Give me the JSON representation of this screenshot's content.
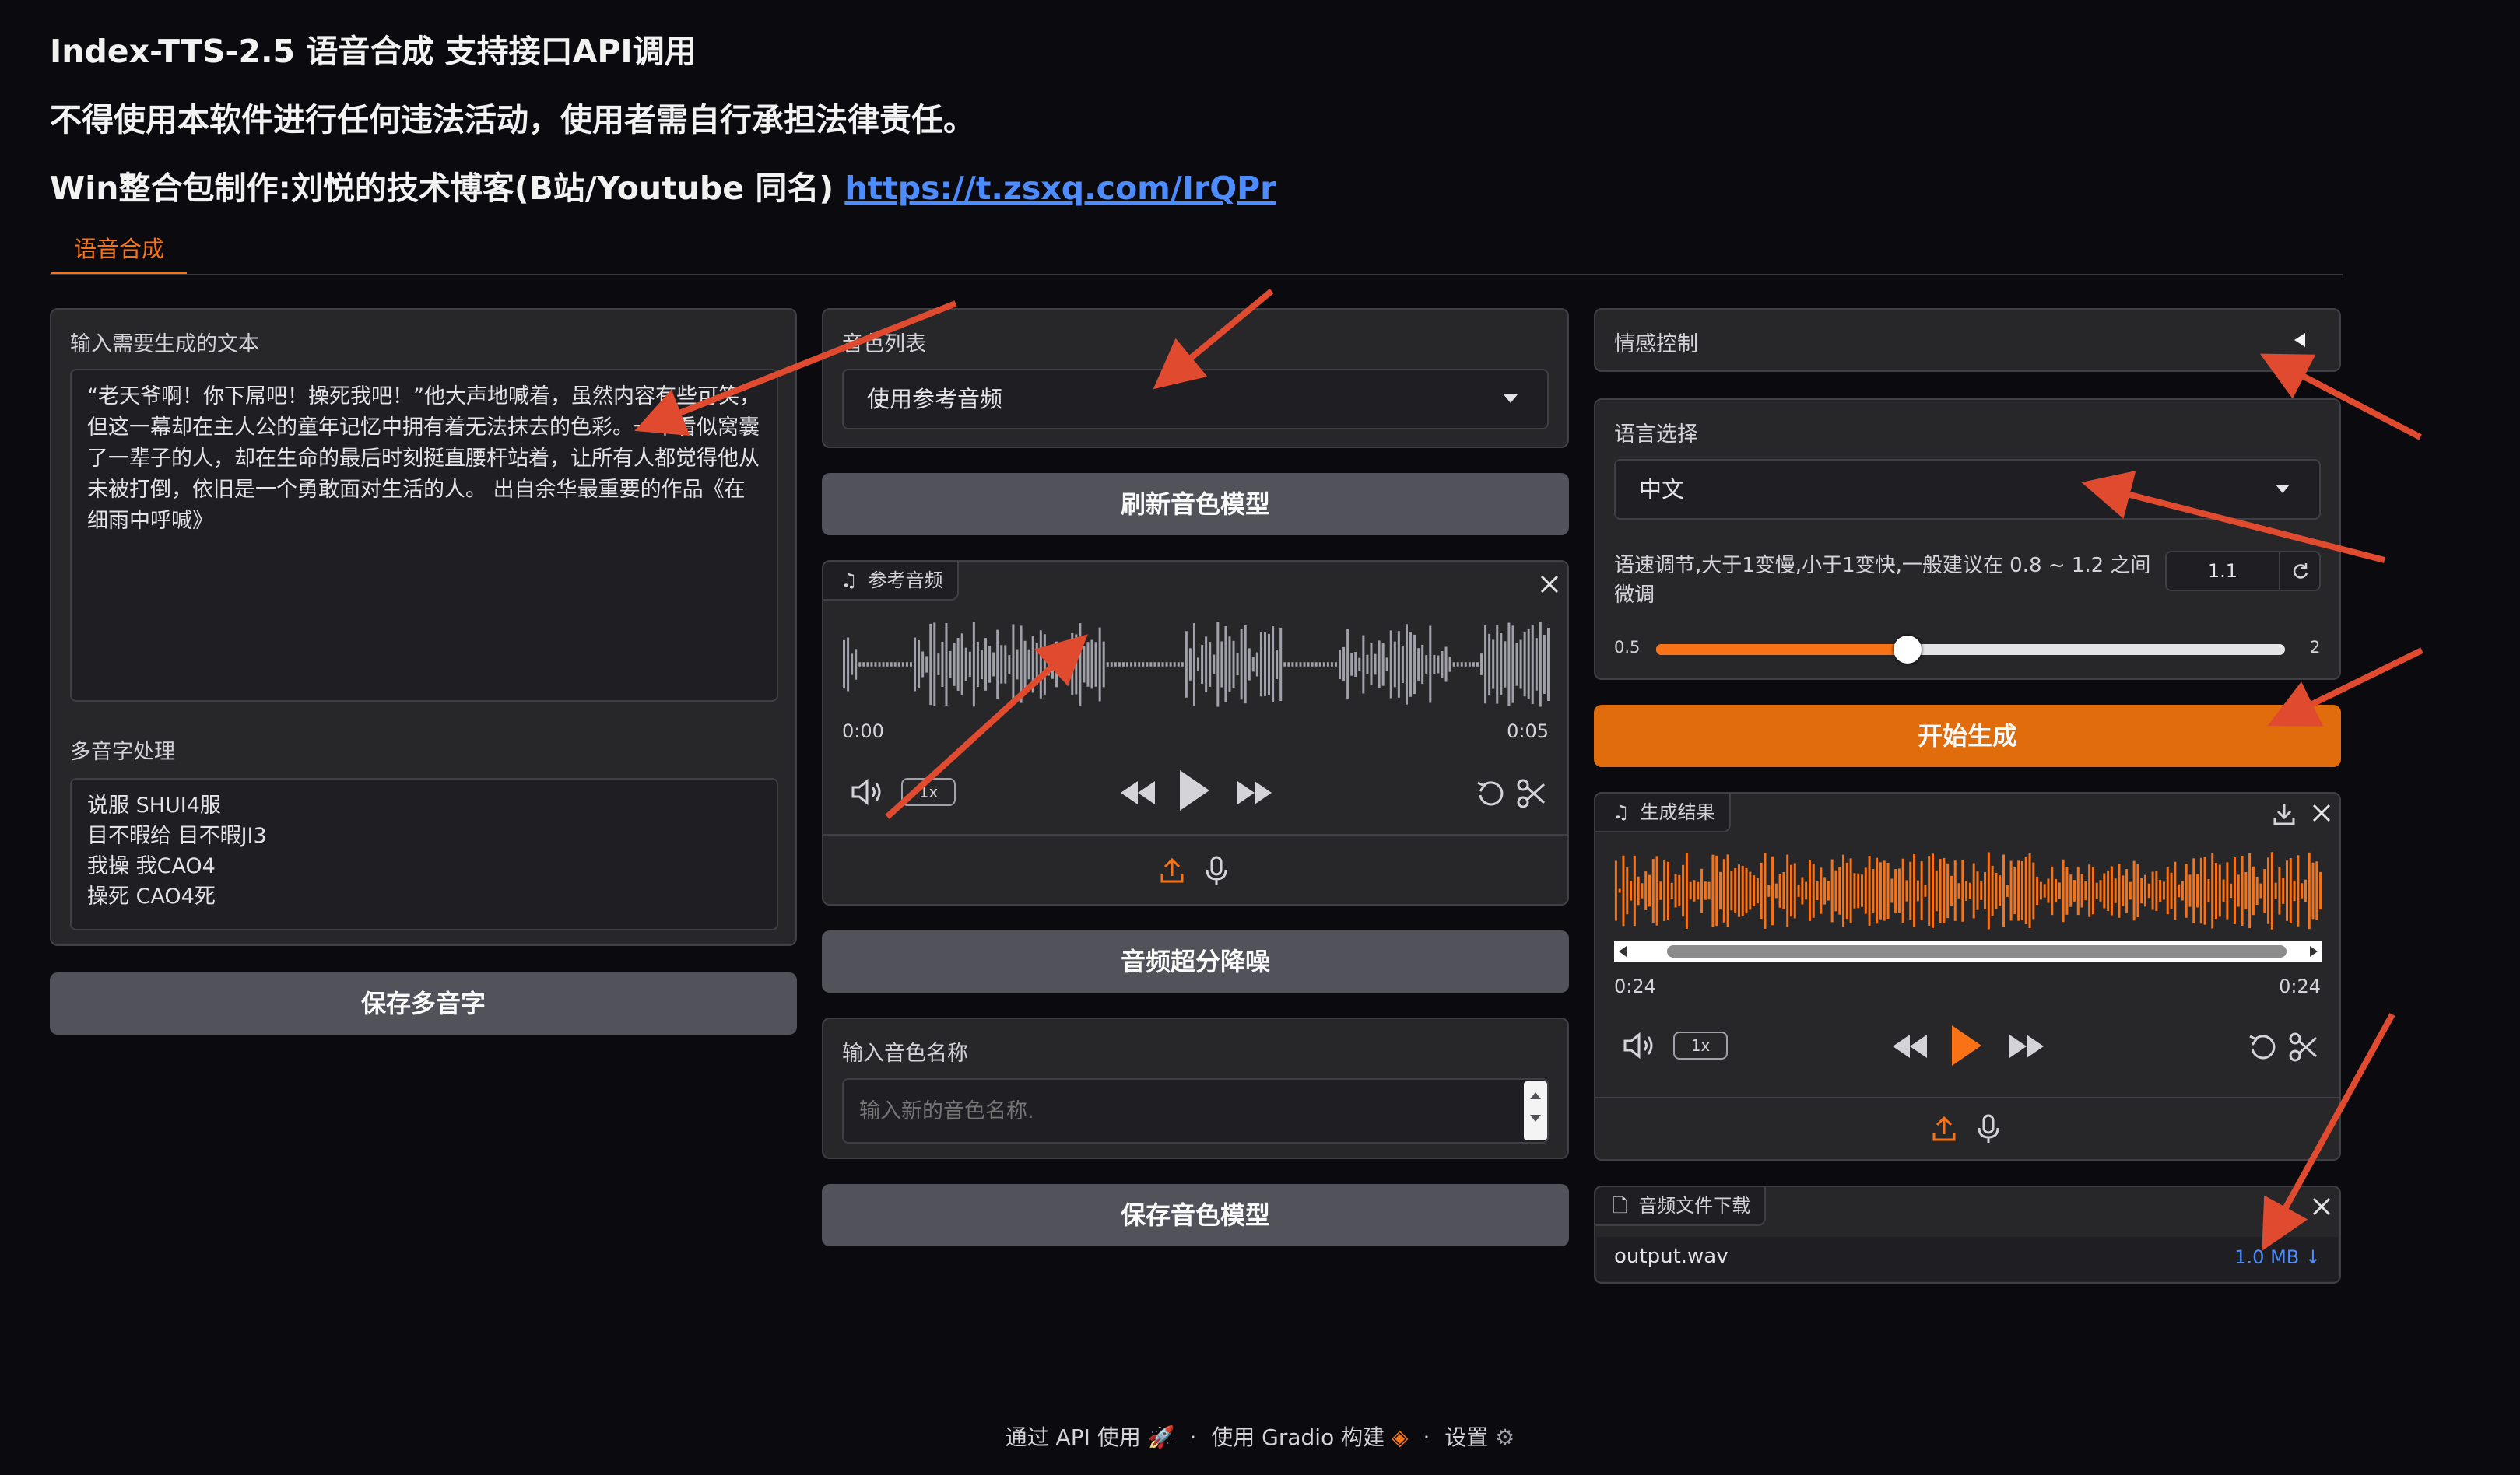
{
  "header": {
    "title": "Index-TTS-2.5 语音合成 支持接口API调用",
    "warning": "不得使用本软件进行任何违法活动，使用者需自行承担法律责任。",
    "credit_text": "Win整合包制作:刘悦的技术博客(B站/Youtube 同名)",
    "credit_link": "https://t.zsxq.com/IrQPr"
  },
  "tabs": [
    {
      "label": "语音合成",
      "active": true
    }
  ],
  "left": {
    "text_label": "输入需要生成的文本",
    "text_value": "“老天爷啊！你下屌吧！操死我吧！”他大声地喊着，虽然内容有些可笑，但这一幕却在主人公的童年记忆中拥有着无法抹去的色彩。一个看似窝囊了一辈子的人，却在生命的最后时刻挺直腰杆站着，让所有人都觉得他从未被打倒，依旧是一个勇敢面对生活的人。 出自余华最重要的作品《在细雨中呼喊》",
    "poly_label": "多音字处理",
    "poly_value": "说服 SHUI4服\n目不暇给 目不暇JI3\n我操 我CAO4\n操死 CAO4死",
    "save_poly": "保存多音字"
  },
  "middle": {
    "voice_list_label": "音色列表",
    "voice_list_value": "使用参考音频",
    "refresh": "刷新音色模型",
    "ref_audio_label": "参考音频",
    "ref_time_start": "0:00",
    "ref_time_end": "0:05",
    "ref_rate": "1x",
    "denoise": "音频超分降噪",
    "name_label": "输入音色名称",
    "name_placeholder": "输入新的音色名称.",
    "save_voice": "保存音色模型"
  },
  "right": {
    "emotion_label": "情感控制",
    "lang_label": "语言选择",
    "lang_value": "中文",
    "speed_label": "语速调节,大于1变慢,小于1变快,一般建议在 0.8 ~ 1.2 之间微调",
    "speed_value": "1.1",
    "speed_min": "0.5",
    "speed_max": "2",
    "speed_fraction": 0.4,
    "generate": "开始生成",
    "result_label": "生成结果",
    "result_time_start": "0:24",
    "result_time_end": "0:24",
    "result_rate": "1x",
    "download_label": "音频文件下载",
    "file_name": "output.wav",
    "file_size": "1.0 MB ↓"
  },
  "footer": {
    "api": "通过 API 使用",
    "built": "使用 Gradio 构建",
    "settings": "设置",
    "sep": "·"
  },
  "colors": {
    "accent": "#f97316",
    "primary_button": "#e06c0c",
    "link": "#4c8cff",
    "arrow": "#e04a2f"
  }
}
